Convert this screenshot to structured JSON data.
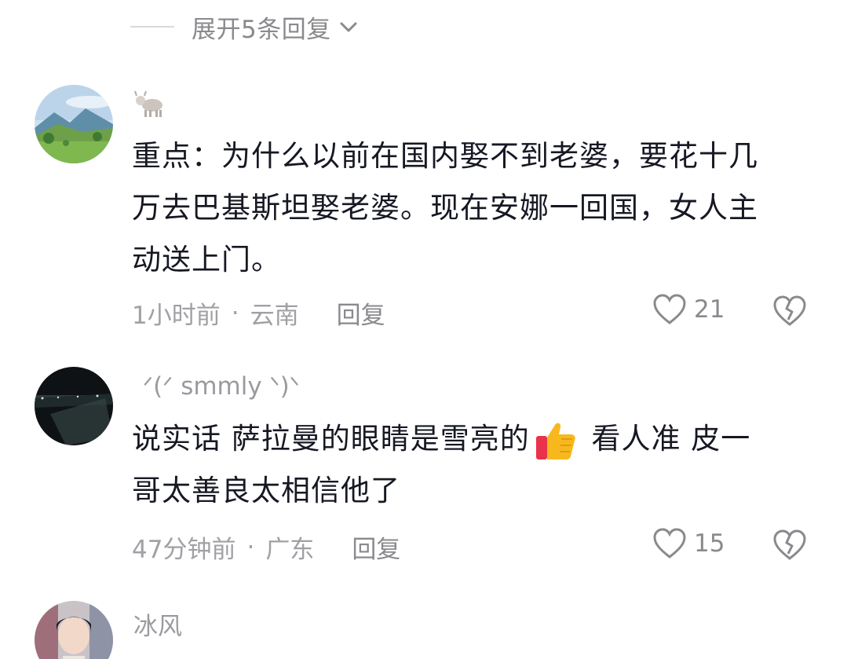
{
  "expand": {
    "label": "展开5条回复"
  },
  "comments": [
    {
      "username": "",
      "text_line1": "重点：为什么以前在国内娶不到老婆，要花十几",
      "text_line2": "万去巴基斯坦娶老婆。现在安娜一回国，女人主",
      "text_line3": "动送上门。",
      "time": "1小时前",
      "location": "云南",
      "reply_label": "回复",
      "likes": "21"
    },
    {
      "username": "ᐟ(ᐟ smmly ᐠ)ᐠ",
      "text_part1": "说实话 萨拉曼的眼睛是雪亮的",
      "text_part2": " 看人准 皮一",
      "text_line2": "哥太善良太相信他了",
      "time": "47分钟前",
      "location": "广东",
      "reply_label": "回复",
      "likes": "15"
    },
    {
      "username": "冰风",
      "text_line1": "",
      "time": "",
      "location": "",
      "reply_label": "",
      "likes": ""
    }
  ],
  "colors": {
    "text": "#161823",
    "meta": "#a0a0a5",
    "divider": "#d9d9d9"
  }
}
